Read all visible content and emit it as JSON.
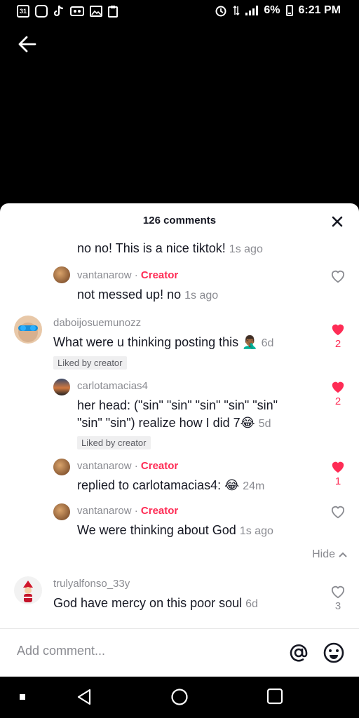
{
  "status_bar": {
    "battery": "6%",
    "time": "6:21 PM",
    "calendar_day": "31"
  },
  "sheet": {
    "comment_count_label": "126 comments",
    "comments": [
      {
        "text": "no no! This is a nice tiktok!",
        "time": "1s ago"
      },
      {
        "username": "vantanarow",
        "badge": "Creator",
        "text": "not messed up! no",
        "time": "1s ago"
      },
      {
        "username": "daboijosuemunozz",
        "text": "What were u thinking posting this",
        "emoji": "🤦🏾‍♂️",
        "time": "6d",
        "liked_by": "Liked by creator",
        "likes": "2"
      },
      {
        "username": "carlotamacias4",
        "text_line1": "her head: (\"sin\" \"sin\" \"sin\" \"sin\" \"sin\"",
        "text_line2": "\"sin\" \"sin\") realize how I did 7",
        "emoji": "😂",
        "time": "5d",
        "liked_by": "Liked by creator",
        "likes": "2"
      },
      {
        "username": "vantanarow",
        "badge": "Creator",
        "text": "replied to carlotamacias4:",
        "emoji": "😂",
        "time": "24m",
        "likes": "1"
      },
      {
        "username": "vantanarow",
        "badge": "Creator",
        "text": "We were thinking about God",
        "time": "1s ago"
      },
      {
        "username": "trulyalfonso_33y",
        "text": "God have mercy on this poor soul",
        "time": "6d",
        "likes": "3"
      }
    ],
    "hide_label": "Hide"
  },
  "composer": {
    "placeholder": "Add comment..."
  },
  "colors": {
    "accent": "#fe2c55",
    "text": "#161823",
    "muted": "#8a8b91"
  }
}
